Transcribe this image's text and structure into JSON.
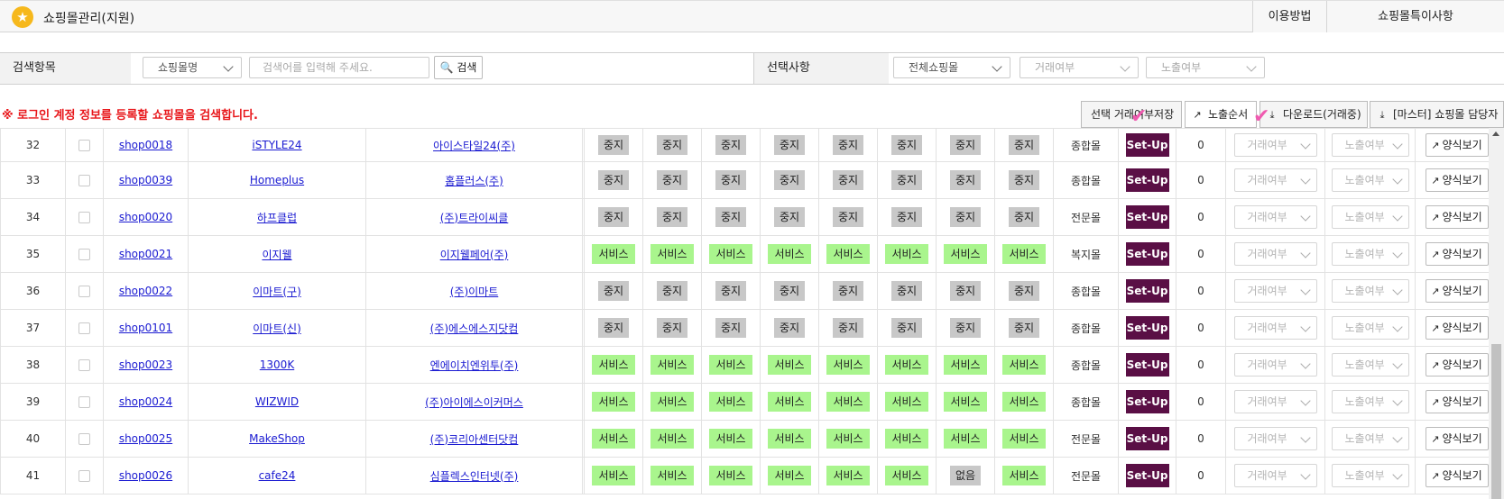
{
  "header": {
    "title": "쇼핑몰관리(지원)",
    "icon": "star-icon",
    "buttons": [
      "이용방법",
      "쇼핑몰특이사항"
    ]
  },
  "search": {
    "label": "검색항목",
    "field_select": "쇼핑몰명",
    "input_placeholder": "검색어를 입력해 주세요.",
    "search_button": "검색",
    "selection_label": "선택사항",
    "filter_mall": "전체쇼핑몰",
    "filter_trade": "거래여부",
    "filter_exposure": "노출여부"
  },
  "notice": "※ 로그인 계정 정보를 등록할 쇼핑몰을 검색합니다.",
  "toolbar": {
    "save_trade": "선택 거래여부저장",
    "exposure_order": "노출순서",
    "download": "다운로드(거래중)",
    "master_manager": "[마스터] 쇼핑몰 담당자"
  },
  "row_controls": {
    "setup": "Set-Up",
    "trade_placeholder": "거래여부",
    "exposure_placeholder": "노출여부",
    "view_form": "양식보기"
  },
  "colors": {
    "stop": "#c8c8c8",
    "service": "#a9f58d",
    "setup": "#5a0f45",
    "notice": "#e8161a",
    "link": "#1a1ad1"
  },
  "rows": [
    {
      "no": "32",
      "code": "shop0018",
      "name": "iSTYLE24",
      "company": "아이스타일24(주)",
      "status": [
        "중지",
        "중지",
        "중지",
        "중지",
        "중지",
        "중지",
        "중지",
        "중지"
      ],
      "type": "종합몰",
      "count": "0"
    },
    {
      "no": "33",
      "code": "shop0039",
      "name": "Homeplus",
      "company": "홈플러스(주)",
      "status": [
        "중지",
        "중지",
        "중지",
        "중지",
        "중지",
        "중지",
        "중지",
        "중지"
      ],
      "type": "종합몰",
      "count": "0"
    },
    {
      "no": "34",
      "code": "shop0020",
      "name": "하프클럽",
      "company": "(주)트라이씨클",
      "status": [
        "중지",
        "중지",
        "중지",
        "중지",
        "중지",
        "중지",
        "중지",
        "중지"
      ],
      "type": "전문몰",
      "count": "0"
    },
    {
      "no": "35",
      "code": "shop0021",
      "name": "이지웰",
      "company": "이지웰페어(주)",
      "status": [
        "서비스",
        "서비스",
        "서비스",
        "서비스",
        "서비스",
        "서비스",
        "서비스",
        "서비스"
      ],
      "type": "복지몰",
      "count": "0"
    },
    {
      "no": "36",
      "code": "shop0022",
      "name": "이마트(구)",
      "company": "(주)이마트",
      "status": [
        "중지",
        "중지",
        "중지",
        "중지",
        "중지",
        "중지",
        "중지",
        "중지"
      ],
      "type": "종합몰",
      "count": "0"
    },
    {
      "no": "37",
      "code": "shop0101",
      "name": "이마트(신)",
      "company": "(주)에스에스지닷컴",
      "status": [
        "중지",
        "중지",
        "중지",
        "중지",
        "중지",
        "중지",
        "중지",
        "중지"
      ],
      "type": "종합몰",
      "count": "0"
    },
    {
      "no": "38",
      "code": "shop0023",
      "name": "1300K",
      "company": "엔에이치엔위투(주)",
      "status": [
        "서비스",
        "서비스",
        "서비스",
        "서비스",
        "서비스",
        "서비스",
        "서비스",
        "서비스"
      ],
      "type": "종합몰",
      "count": "0"
    },
    {
      "no": "39",
      "code": "shop0024",
      "name": "WIZWID",
      "company": "(주)아이에스이커머스",
      "status": [
        "서비스",
        "서비스",
        "서비스",
        "서비스",
        "서비스",
        "서비스",
        "서비스",
        "서비스"
      ],
      "type": "종합몰",
      "count": "0"
    },
    {
      "no": "40",
      "code": "shop0025",
      "name": "MakeShop",
      "company": "(주)코리아센터닷컴",
      "status": [
        "서비스",
        "서비스",
        "서비스",
        "서비스",
        "서비스",
        "서비스",
        "서비스",
        "서비스"
      ],
      "type": "전문몰",
      "count": "0"
    },
    {
      "no": "41",
      "code": "shop0026",
      "name": "cafe24",
      "company": "심플렉스인터넷(주)",
      "status": [
        "서비스",
        "서비스",
        "서비스",
        "서비스",
        "서비스",
        "서비스",
        "없음",
        "서비스"
      ],
      "type": "전문몰",
      "count": "0"
    }
  ]
}
